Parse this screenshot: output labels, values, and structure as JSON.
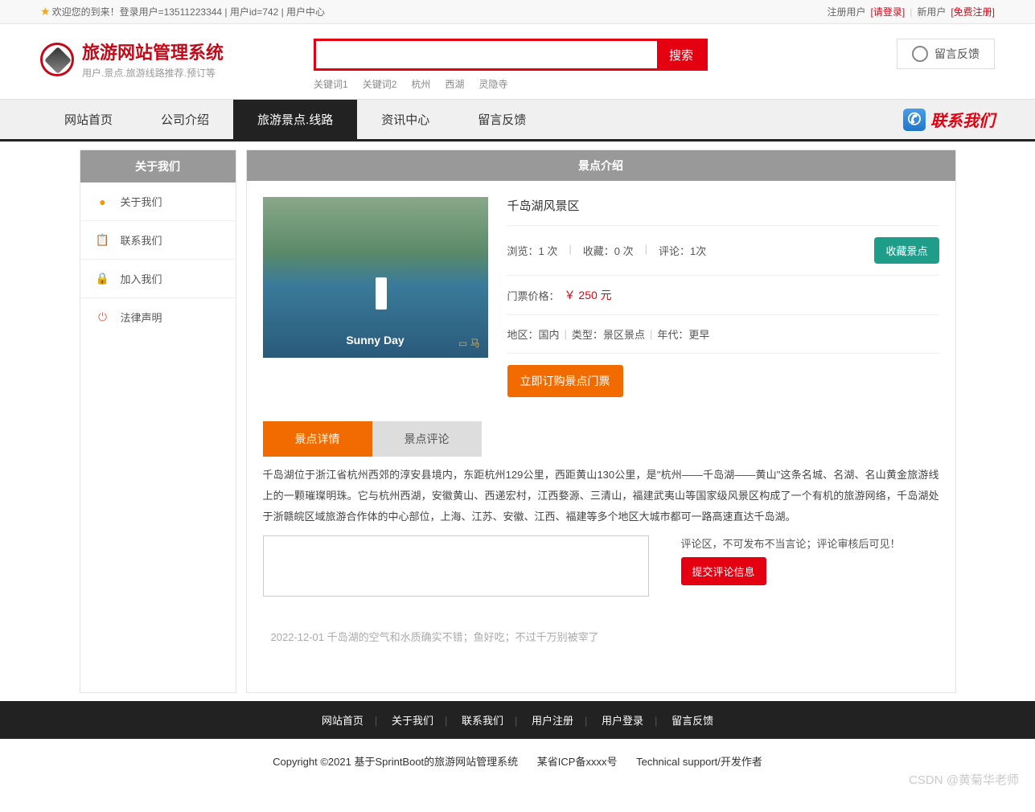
{
  "topbar": {
    "welcome": "欢迎您的到来！登录用户=13511223344 | 用户id=742 | 用户中心",
    "reg_label": "注册用户",
    "login_link": "[请登录]",
    "new_label": "新用户",
    "free_reg": "[免费注册]"
  },
  "logo": {
    "title": "旅游网站管理系统",
    "subtitle": "用户.景点.旅游线路推荐.预订等"
  },
  "search": {
    "button": "搜索",
    "keywords": [
      "关键词1",
      "关键词2",
      "杭州",
      "西湖",
      "灵隐寺"
    ]
  },
  "header_feedback": "留言反馈",
  "nav": {
    "items": [
      "网站首页",
      "公司介绍",
      "旅游景点.线路",
      "资讯中心",
      "留言反馈"
    ],
    "active_index": 2,
    "contact": "联系我们"
  },
  "sidebar": {
    "header": "关于我们",
    "items": [
      {
        "label": "关于我们",
        "icon": "●",
        "cls": "ic-orange"
      },
      {
        "label": "联系我们",
        "icon": "📋",
        "cls": "ic-blue"
      },
      {
        "label": "加入我们",
        "icon": "🔒",
        "cls": "ic-orange"
      },
      {
        "label": "法律声明",
        "icon": "⏻",
        "cls": "ic-red"
      }
    ]
  },
  "main": {
    "header": "景点介绍",
    "title": "千岛湖风景区",
    "img_overlay": "Sunny Day",
    "img_tag": "马",
    "stats": {
      "view_label": "浏览：",
      "view_val": "1 次",
      "fav_label": "收藏：",
      "fav_val": "0 次",
      "comment_label": "评论：",
      "comment_val": "1次"
    },
    "fav_btn": "收藏景点",
    "price_label": "门票价格：",
    "price": "￥ 250 元",
    "meta": {
      "region_label": "地区：",
      "region": "国内",
      "type_label": "类型：",
      "type": "景区景点",
      "era_label": "年代：",
      "era": "更早"
    },
    "order_btn": "立即订购景点门票",
    "tabs": [
      "景点详情",
      "景点评论"
    ],
    "description": "千岛湖位于浙江省杭州西郊的淳安县境内，东距杭州129公里，西距黄山130公里，是\"杭州——千岛湖——黄山\"这条名城、名湖、名山黄金旅游线上的一颗璀璨明珠。它与杭州西湖，安徽黄山、西递宏村，江西婺源、三清山，福建武夷山等国家级风景区构成了一个有机的旅游网络，千岛湖处于浙赣皖区域旅游合作体的中心部位，上海、江苏、安徽、江西、福建等多个地区大城市都可一路高速直达千岛湖。",
    "comment_note": "评论区，不可发布不当言论；评论审核后可见！",
    "submit_btn": "提交评论信息",
    "comment_item": "2022-12-01 千岛湖的空气和水质确实不错；鱼好吃；不过千万别被宰了"
  },
  "footer": {
    "nav": [
      "网站首页",
      "关于我们",
      "联系我们",
      "用户注册",
      "用户登录",
      "留言反馈"
    ],
    "copy1": "Copyright ©2021 基于SprintBoot的旅游网站管理系统",
    "copy2": "某省ICP备xxxx号",
    "copy3": "Technical support/开发作者"
  },
  "watermark": "CSDN @黄菊华老师"
}
